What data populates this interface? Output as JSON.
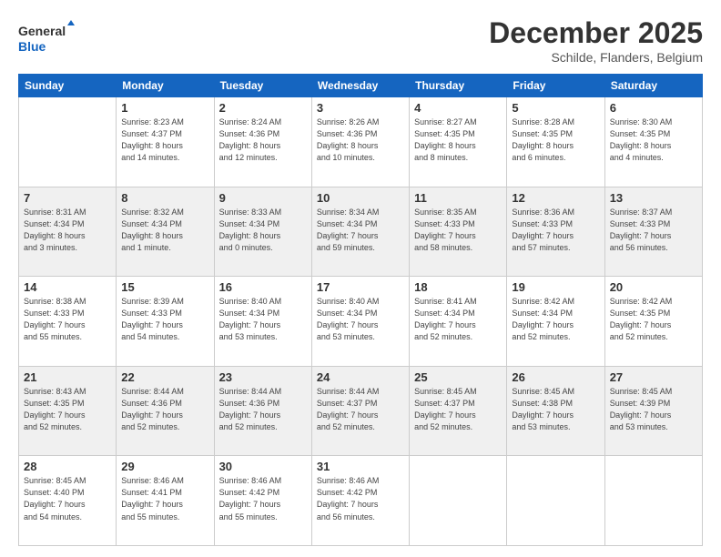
{
  "header": {
    "logo_line1": "General",
    "logo_line2": "Blue",
    "month": "December 2025",
    "location": "Schilde, Flanders, Belgium"
  },
  "weekdays": [
    "Sunday",
    "Monday",
    "Tuesday",
    "Wednesday",
    "Thursday",
    "Friday",
    "Saturday"
  ],
  "weeks": [
    [
      {
        "day": "",
        "info": ""
      },
      {
        "day": "1",
        "info": "Sunrise: 8:23 AM\nSunset: 4:37 PM\nDaylight: 8 hours\nand 14 minutes."
      },
      {
        "day": "2",
        "info": "Sunrise: 8:24 AM\nSunset: 4:36 PM\nDaylight: 8 hours\nand 12 minutes."
      },
      {
        "day": "3",
        "info": "Sunrise: 8:26 AM\nSunset: 4:36 PM\nDaylight: 8 hours\nand 10 minutes."
      },
      {
        "day": "4",
        "info": "Sunrise: 8:27 AM\nSunset: 4:35 PM\nDaylight: 8 hours\nand 8 minutes."
      },
      {
        "day": "5",
        "info": "Sunrise: 8:28 AM\nSunset: 4:35 PM\nDaylight: 8 hours\nand 6 minutes."
      },
      {
        "day": "6",
        "info": "Sunrise: 8:30 AM\nSunset: 4:35 PM\nDaylight: 8 hours\nand 4 minutes."
      }
    ],
    [
      {
        "day": "7",
        "info": "Sunrise: 8:31 AM\nSunset: 4:34 PM\nDaylight: 8 hours\nand 3 minutes."
      },
      {
        "day": "8",
        "info": "Sunrise: 8:32 AM\nSunset: 4:34 PM\nDaylight: 8 hours\nand 1 minute."
      },
      {
        "day": "9",
        "info": "Sunrise: 8:33 AM\nSunset: 4:34 PM\nDaylight: 8 hours\nand 0 minutes."
      },
      {
        "day": "10",
        "info": "Sunrise: 8:34 AM\nSunset: 4:34 PM\nDaylight: 7 hours\nand 59 minutes."
      },
      {
        "day": "11",
        "info": "Sunrise: 8:35 AM\nSunset: 4:33 PM\nDaylight: 7 hours\nand 58 minutes."
      },
      {
        "day": "12",
        "info": "Sunrise: 8:36 AM\nSunset: 4:33 PM\nDaylight: 7 hours\nand 57 minutes."
      },
      {
        "day": "13",
        "info": "Sunrise: 8:37 AM\nSunset: 4:33 PM\nDaylight: 7 hours\nand 56 minutes."
      }
    ],
    [
      {
        "day": "14",
        "info": "Sunrise: 8:38 AM\nSunset: 4:33 PM\nDaylight: 7 hours\nand 55 minutes."
      },
      {
        "day": "15",
        "info": "Sunrise: 8:39 AM\nSunset: 4:33 PM\nDaylight: 7 hours\nand 54 minutes."
      },
      {
        "day": "16",
        "info": "Sunrise: 8:40 AM\nSunset: 4:34 PM\nDaylight: 7 hours\nand 53 minutes."
      },
      {
        "day": "17",
        "info": "Sunrise: 8:40 AM\nSunset: 4:34 PM\nDaylight: 7 hours\nand 53 minutes."
      },
      {
        "day": "18",
        "info": "Sunrise: 8:41 AM\nSunset: 4:34 PM\nDaylight: 7 hours\nand 52 minutes."
      },
      {
        "day": "19",
        "info": "Sunrise: 8:42 AM\nSunset: 4:34 PM\nDaylight: 7 hours\nand 52 minutes."
      },
      {
        "day": "20",
        "info": "Sunrise: 8:42 AM\nSunset: 4:35 PM\nDaylight: 7 hours\nand 52 minutes."
      }
    ],
    [
      {
        "day": "21",
        "info": "Sunrise: 8:43 AM\nSunset: 4:35 PM\nDaylight: 7 hours\nand 52 minutes."
      },
      {
        "day": "22",
        "info": "Sunrise: 8:44 AM\nSunset: 4:36 PM\nDaylight: 7 hours\nand 52 minutes."
      },
      {
        "day": "23",
        "info": "Sunrise: 8:44 AM\nSunset: 4:36 PM\nDaylight: 7 hours\nand 52 minutes."
      },
      {
        "day": "24",
        "info": "Sunrise: 8:44 AM\nSunset: 4:37 PM\nDaylight: 7 hours\nand 52 minutes."
      },
      {
        "day": "25",
        "info": "Sunrise: 8:45 AM\nSunset: 4:37 PM\nDaylight: 7 hours\nand 52 minutes."
      },
      {
        "day": "26",
        "info": "Sunrise: 8:45 AM\nSunset: 4:38 PM\nDaylight: 7 hours\nand 53 minutes."
      },
      {
        "day": "27",
        "info": "Sunrise: 8:45 AM\nSunset: 4:39 PM\nDaylight: 7 hours\nand 53 minutes."
      }
    ],
    [
      {
        "day": "28",
        "info": "Sunrise: 8:45 AM\nSunset: 4:40 PM\nDaylight: 7 hours\nand 54 minutes."
      },
      {
        "day": "29",
        "info": "Sunrise: 8:46 AM\nSunset: 4:41 PM\nDaylight: 7 hours\nand 55 minutes."
      },
      {
        "day": "30",
        "info": "Sunrise: 8:46 AM\nSunset: 4:42 PM\nDaylight: 7 hours\nand 55 minutes."
      },
      {
        "day": "31",
        "info": "Sunrise: 8:46 AM\nSunset: 4:42 PM\nDaylight: 7 hours\nand 56 minutes."
      },
      {
        "day": "",
        "info": ""
      },
      {
        "day": "",
        "info": ""
      },
      {
        "day": "",
        "info": ""
      }
    ]
  ]
}
